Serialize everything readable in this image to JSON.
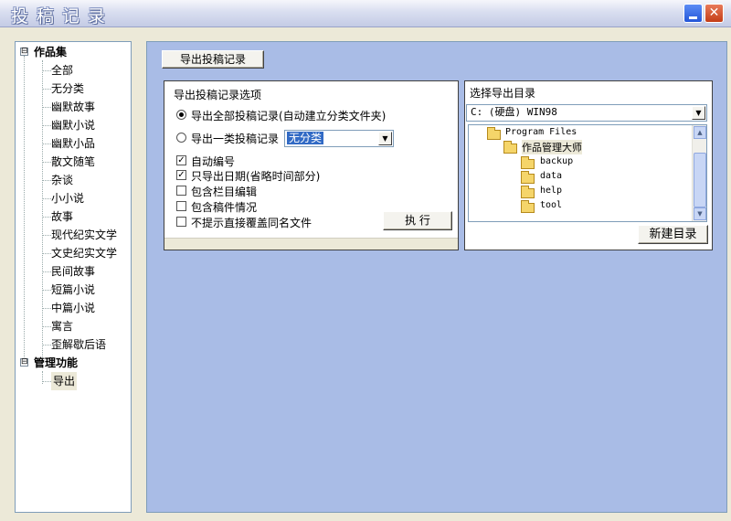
{
  "window": {
    "title": "投稿记录",
    "min_icon": "minimize-icon",
    "close_icon": "close-icon",
    "close_glyph": "✕"
  },
  "tree": {
    "categories": [
      {
        "label": "作品集",
        "expander": "⊟",
        "items": [
          "全部",
          "无分类",
          "幽默故事",
          "幽默小说",
          "幽默小品",
          "散文随笔",
          "杂谈",
          "小小说",
          "故事",
          "现代纪实文学",
          "文史纪实文学",
          "民间故事",
          "短篇小说",
          "中篇小说",
          "寓言",
          "歪解歇后语"
        ]
      },
      {
        "label": "管理功能",
        "expander": "⊟",
        "items": [
          "导出"
        ]
      }
    ],
    "selected": "导出"
  },
  "export_tab": {
    "label": "导出投稿记录"
  },
  "options": {
    "title": "导出投稿记录选项",
    "radio_all": "导出全部投稿记录(自动建立分类文件夹)",
    "radio_one": "导出一类投稿记录",
    "category_select": "无分类",
    "checks": [
      {
        "label": "自动编号",
        "checked": true
      },
      {
        "label": "只导出日期(省略时间部分)",
        "checked": true
      },
      {
        "label": "包含栏目编辑",
        "checked": false
      },
      {
        "label": "包含稿件情况",
        "checked": false
      },
      {
        "label": "不提示直接覆盖同名文件",
        "checked": false
      }
    ],
    "execute": "执 行"
  },
  "directory": {
    "title": "选择导出目录",
    "drive": "C: (硬盘) WIN98",
    "folders": {
      "root": "Program Files",
      "current": "作品管理大师",
      "children": [
        "backup",
        "data",
        "help",
        "tool"
      ]
    },
    "new_dir": "新建目录"
  }
}
